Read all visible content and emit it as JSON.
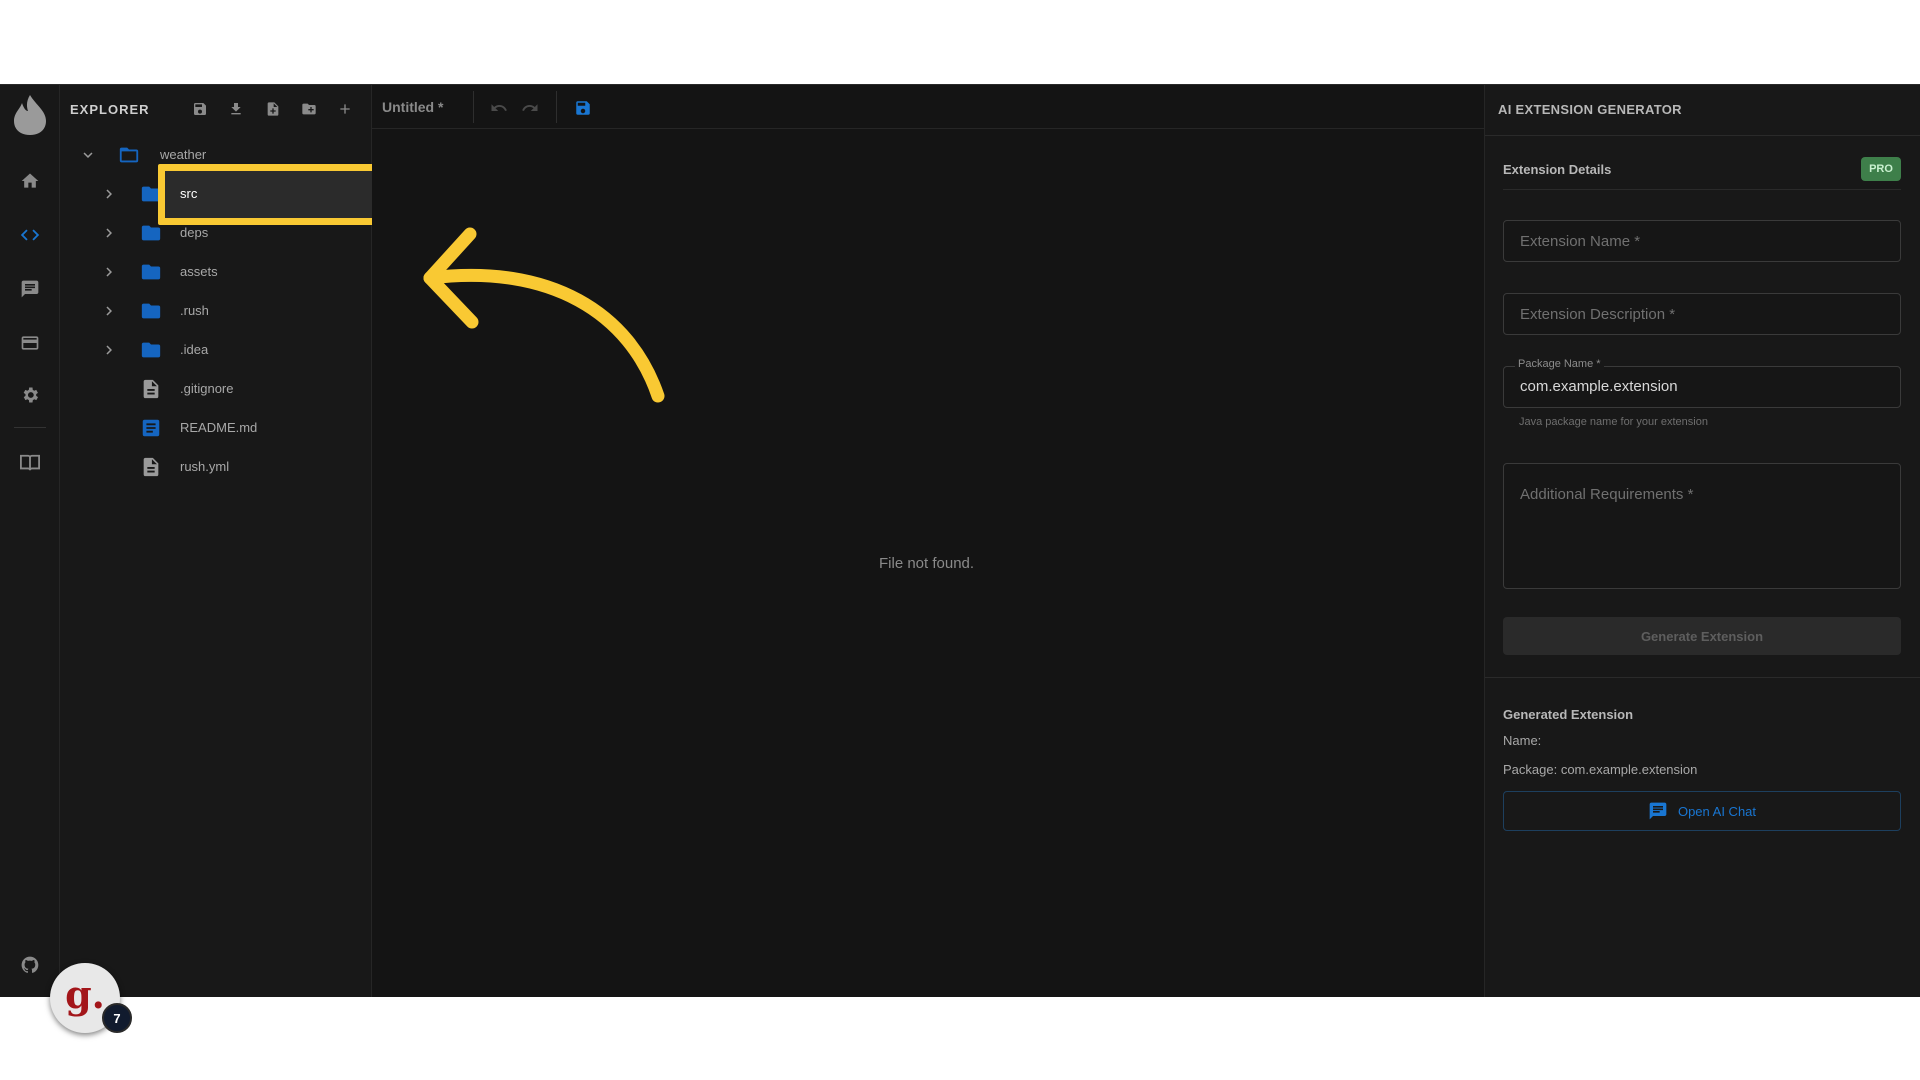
{
  "explorer": {
    "title": "EXPLORER",
    "tree": [
      {
        "name": "weather",
        "kind": "folder-open",
        "expanded": true
      },
      {
        "name": "src",
        "kind": "folder",
        "selected": true
      },
      {
        "name": "deps",
        "kind": "folder"
      },
      {
        "name": "assets",
        "kind": "folder"
      },
      {
        "name": ".rush",
        "kind": "folder"
      },
      {
        "name": ".idea",
        "kind": "folder"
      },
      {
        "name": ".gitignore",
        "kind": "file"
      },
      {
        "name": "README.md",
        "kind": "markdown"
      },
      {
        "name": "rush.yml",
        "kind": "file"
      }
    ]
  },
  "editor": {
    "tab_title": "Untitled *",
    "empty_message": "File not found."
  },
  "panel": {
    "title": "AI EXTENSION GENERATOR",
    "details_title": "Extension Details",
    "pro_badge": "PRO",
    "name_placeholder": "Extension Name *",
    "description_placeholder": "Extension Description *",
    "package_label": "Package Name *",
    "package_value": "com.example.extension",
    "package_helper": "Java package name for your extension",
    "requirements_placeholder": "Additional Requirements *",
    "generate_button": "Generate Extension",
    "generated_title": "Generated Extension",
    "generated_name": "Name:",
    "generated_package": "Package: com.example.extension",
    "chat_button": "Open AI Chat"
  },
  "avatar": {
    "letter": "g.",
    "notification_count": "7"
  },
  "colors": {
    "accent": "#1976d2",
    "folder": "#1565c0",
    "highlight": "#f9c933",
    "pro": "#3e7f4a"
  }
}
